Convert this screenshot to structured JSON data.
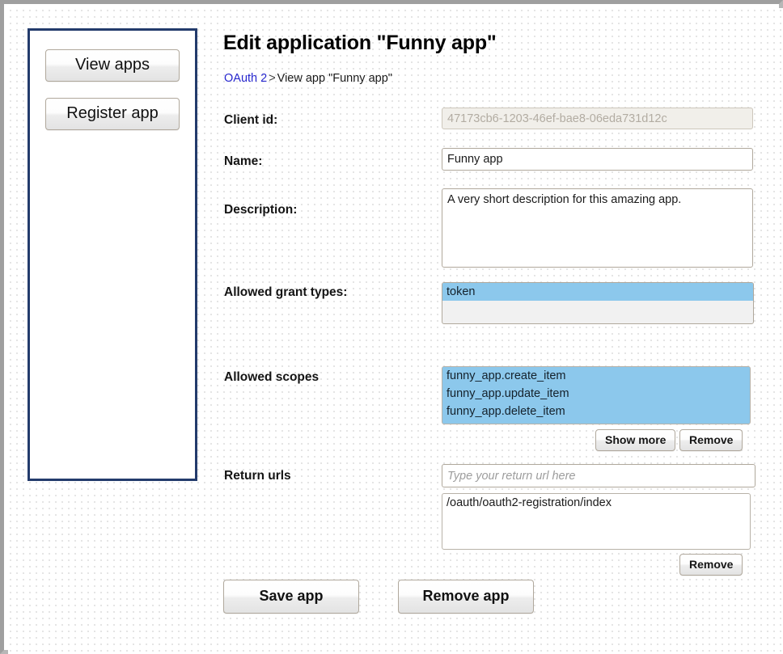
{
  "sidebar": {
    "buttons": [
      {
        "label": "View apps",
        "name": "view-apps-button"
      },
      {
        "label": "Register app",
        "name": "register-app-button"
      }
    ]
  },
  "header": {
    "title": "Edit application \"Funny app\"",
    "breadcrumb": {
      "link_label": "OAuth 2",
      "separator": ">",
      "current": "View app \"Funny app\""
    }
  },
  "form": {
    "client_id": {
      "label": "Client id:",
      "value": "47173cb6-1203-46ef-bae8-06eda731d12c",
      "disabled": "true"
    },
    "name": {
      "label": "Name:",
      "value": "Funny app"
    },
    "description": {
      "label": "Description:",
      "value": "A very short description for this amazing app."
    },
    "allowed_grant_types": {
      "label": "Allowed grant types:",
      "options": [
        {
          "label": "token",
          "selected": true
        }
      ]
    },
    "allowed_scopes": {
      "label": "Allowed scopes",
      "options": [
        {
          "label": "funny_app.create_item",
          "selected": true
        },
        {
          "label": "funny_app.update_item",
          "selected": true
        },
        {
          "label": "funny_app.delete_item",
          "selected": true
        }
      ],
      "show_more_label": "Show more",
      "remove_label": "Remove"
    },
    "return_urls": {
      "label": "Return urls",
      "input_value": "",
      "input_placeholder": "Type your return url here",
      "items": [
        {
          "label": "/oauth/oauth2-registration/index",
          "selected": false
        }
      ],
      "remove_label": "Remove"
    }
  },
  "actions": {
    "save_label": "Save app",
    "remove_label": "Remove app"
  },
  "colors": {
    "selection_blue": "#8cc8ec",
    "sidebar_border": "#233b6c",
    "link_blue": "#2727cf"
  }
}
